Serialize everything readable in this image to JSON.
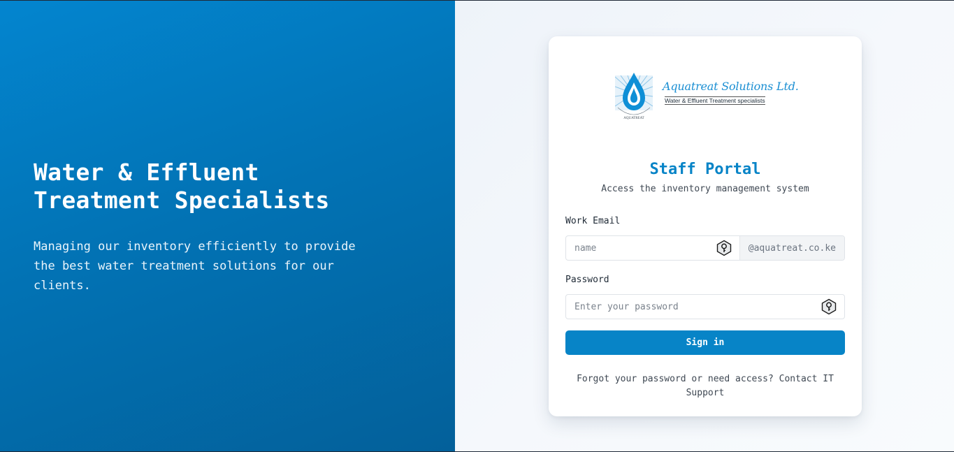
{
  "hero": {
    "title_line1": "Water & Effluent",
    "title_line2": "Treatment Specialists",
    "description": "Managing our inventory efficiently to provide the best water treatment solutions for our clients."
  },
  "logo": {
    "company_name": "Aquatreat Solutions Ltd.",
    "tagline": "Water & Effluent Treatment specialists",
    "mark_text": "AQUATREAT"
  },
  "portal": {
    "title": "Staff Portal",
    "subtitle": "Access the inventory management system"
  },
  "form": {
    "email_label": "Work Email",
    "email_placeholder": "name",
    "email_suffix": "@aquatreat.co.ke",
    "password_label": "Password",
    "password_placeholder": "Enter your password",
    "submit_label": "Sign in",
    "help_text": "Forgot your password or need access? Contact IT Support"
  },
  "colors": {
    "brand_blue": "#0784c7",
    "hero_gradient_start": "#0385cf",
    "hero_gradient_end": "#03609a"
  },
  "icons": {
    "field_icon": "key-icon"
  }
}
